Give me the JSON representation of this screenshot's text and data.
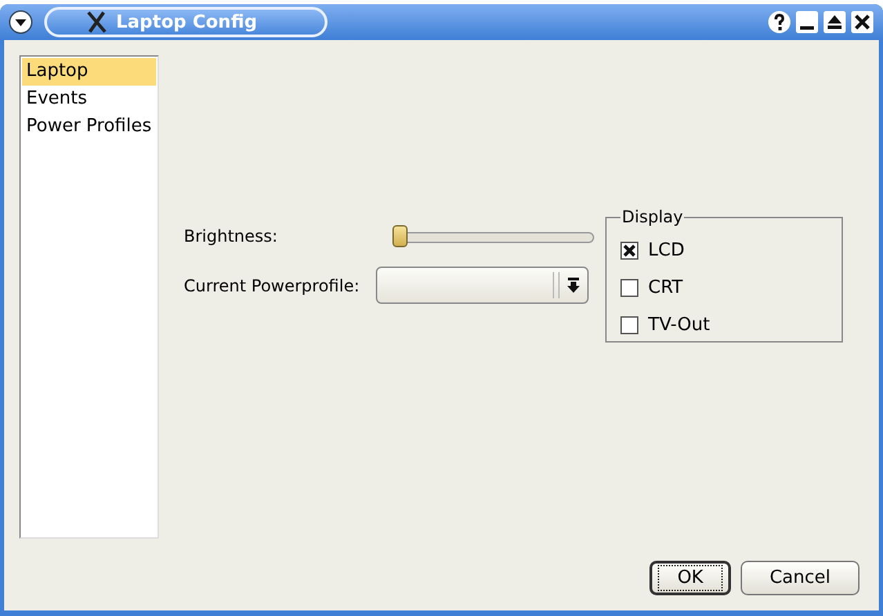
{
  "window": {
    "title": "Laptop Config"
  },
  "sidebar": {
    "items": [
      {
        "label": "Laptop",
        "selected": true
      },
      {
        "label": "Events",
        "selected": false
      },
      {
        "label": "Power Profiles",
        "selected": false
      }
    ]
  },
  "brightness": {
    "label": "Brightness:",
    "level": 0
  },
  "powerprofile": {
    "label": "Current Powerprofile:"
  },
  "display": {
    "title": "Display",
    "options": [
      {
        "label": "LCD",
        "checked": true
      },
      {
        "label": "CRT",
        "checked": false
      },
      {
        "label": "TV-Out",
        "checked": false
      }
    ]
  },
  "buttons": [
    {
      "label": "OK",
      "default": true
    },
    {
      "label": "Cancel",
      "default": false
    }
  ]
}
